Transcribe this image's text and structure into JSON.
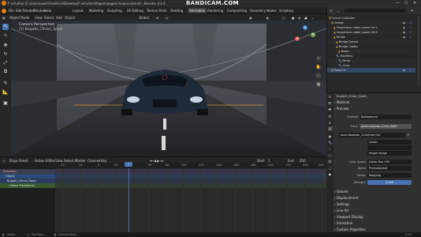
{
  "window": {
    "title": "F-schultze [C:\\Users\\user\\OneDrive\\Desktop\\F-schultze\\Pagani\\pagani-huayra.blend] - Blender 4.1.0",
    "watermark_brand": "BANDICAM",
    "watermark_domain": ".COM"
  },
  "menubar": {
    "menus": [
      "File",
      "Edit",
      "Render",
      "Window",
      "Help"
    ],
    "workspaces": [
      "Layout",
      "Modeling",
      "Sculpting",
      "UV Editing",
      "Texture Paint",
      "Shading",
      "Animation",
      "Rendering",
      "Compositing",
      "Geometry Nodes",
      "Scripting"
    ],
    "active_workspace": "Animation",
    "scene_label": "Scene",
    "view_layer_label": "ViewLayer"
  },
  "viewport": {
    "header": {
      "mode": "Object Mode",
      "menus": [
        "View",
        "Select",
        "Add",
        "Object"
      ],
      "transform_orientation": "Global"
    },
    "overlay_title": "Camera Perspective",
    "overlay_subtitle": "(1) Bugatti_Chiron_Sport"
  },
  "toolbar": {
    "tools": [
      "cursor-icon",
      "select-box-icon",
      "move-icon",
      "rotate-icon",
      "scale-icon",
      "transform-icon",
      "annotate-icon",
      "measure-icon"
    ]
  },
  "timeline": {
    "header": {
      "editor": "Dope Sheet",
      "mode": "Action Editor",
      "menus": [
        "View",
        "Select",
        "Marker",
        "Channel",
        "Key"
      ],
      "summary_label": "Summary",
      "only_show_selected": "Only Show Selected",
      "start_label": "Start",
      "start_value": "1",
      "end_label": "End",
      "end_value": "250"
    },
    "ruler_ticks": [
      "-40",
      "-20",
      "0",
      "20",
      "40",
      "60",
      "80",
      "100",
      "120",
      "140",
      "160",
      "180",
      "200",
      "220",
      "240",
      "260",
      "280"
    ],
    "current_frame": "1",
    "channels": [
      {
        "label": "Summary",
        "level": 0
      },
      {
        "label": "Object",
        "level": 1
      },
      {
        "label": "Bugatti_Chiron_Sport",
        "level": 1
      },
      {
        "label": "Object Transforms",
        "level": 2
      }
    ]
  },
  "outliner": {
    "search_placeholder": "",
    "rows": [
      {
        "label": "Scene Collection",
        "icon": "collection-icon",
        "depth": 0
      },
      {
        "label": "Bridge",
        "icon": "collection-icon",
        "depth": 1
      },
      {
        "label": "Suspension cable_Lower rib 5",
        "icon": "object-icon",
        "depth": 2
      },
      {
        "label": "Suspension cable_Lower rib 6",
        "icon": "object-icon",
        "depth": 2
      },
      {
        "label": "Bridge",
        "icon": "object-icon",
        "depth": 2
      },
      {
        "label": "Bridge Details",
        "icon": "object-icon",
        "depth": 3
      },
      {
        "label": "Bridge Cables",
        "icon": "object-icon",
        "depth": 3
      },
      {
        "label": "Beam",
        "icon": "object-icon",
        "depth": 4
      },
      {
        "label": "Modifiers",
        "icon": "wrench-icon",
        "depth": 3
      },
      {
        "label": "Mirror",
        "icon": "wrench-icon",
        "depth": 4
      },
      {
        "label": "Array",
        "icon": "wrench-icon",
        "depth": 4
      },
      {
        "label": "Road FX",
        "icon": "collection-icon",
        "depth": 1
      }
    ]
  },
  "properties": {
    "header_object": "Bugatti_Chiron_Sport",
    "sections": {
      "material": "Material",
      "preview": "Preview",
      "surface": "Surface",
      "volume": "Volume",
      "displacement": "Displacement",
      "settings": "Settings",
      "line_art": "Line Art",
      "viewport_display": "Viewport Display",
      "animation": "Animation",
      "custom_properties": "Custom Properties"
    },
    "surface_label": "Surface",
    "surface_value": "Background",
    "color_label": "Color",
    "color_value": "road.shadows_2.hdr_HDRI",
    "image_name": "road shadows_2.hdr/hdri.hdr",
    "projection_label": "Linear",
    "single_image_label": "Single Image",
    "color_space_label": "Color Space",
    "color_space_value": "Linear Rec.709",
    "alpha_label": "Alpha",
    "alpha_value": "Premultiplied",
    "vector_label": "Vector",
    "vector_value": "Mapping",
    "strength_label": "Strength",
    "strength_value": "1.000"
  },
  "statusbar": {
    "left": "Select",
    "middle_1": "Pan View",
    "middle_2": "Context Menu",
    "right": "4.1.0"
  },
  "colors": {
    "accent": "#4772b3",
    "active_tab": "#e8a052",
    "bg_dark": "#1d1d1d"
  }
}
